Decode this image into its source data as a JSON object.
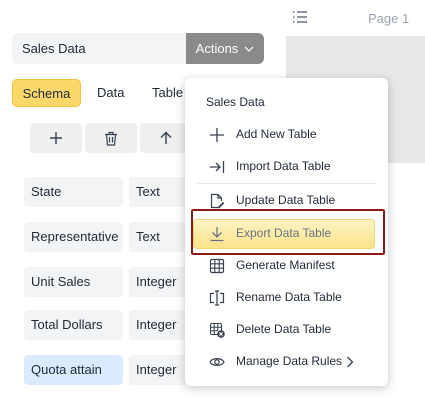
{
  "document": {
    "page_label": "Page 1"
  },
  "toolbar": {
    "table_name_value": "Sales Data",
    "actions_label": "Actions"
  },
  "tabs": [
    "Schema",
    "Data",
    "Table"
  ],
  "fields": [
    {
      "name": "State",
      "type": "Text"
    },
    {
      "name": "Representative",
      "type": "Text"
    },
    {
      "name": "Unit Sales",
      "type": "Integer"
    },
    {
      "name": "Total Dollars",
      "type": "Integer"
    },
    {
      "name": "Quota attain",
      "type": "Integer"
    }
  ],
  "menu": {
    "title": "Sales Data",
    "items": [
      {
        "label": "Add New Table",
        "icon": "plus-icon"
      },
      {
        "label": "Import Data Table",
        "icon": "import-icon"
      },
      {
        "label": "Update Data Table",
        "icon": "document-edit-icon"
      },
      {
        "label": "Export Data Table",
        "icon": "download-icon",
        "highlighted": true
      },
      {
        "label": "Generate Manifest",
        "icon": "table-grid-icon"
      },
      {
        "label": "Rename Data Table",
        "icon": "text-cursor-icon"
      },
      {
        "label": "Delete Data Table",
        "icon": "table-delete-icon"
      },
      {
        "label": "Manage Data Rules",
        "icon": "eye-icon"
      }
    ]
  },
  "colors": {
    "accent_tab": "#fcd76a",
    "actions_button": "#8a8a8a",
    "highlight": "#fbe48a",
    "focus_frame": "#8b1a1a"
  }
}
